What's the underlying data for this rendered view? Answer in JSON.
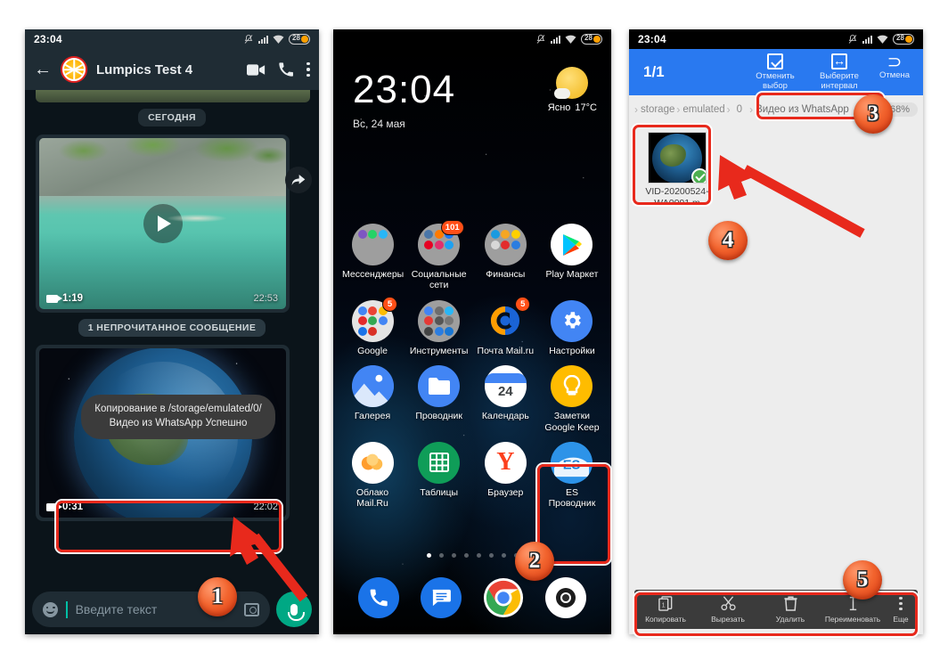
{
  "panels": {
    "whatsapp": {
      "status": {
        "time": "23:04",
        "battery": "28"
      },
      "appbar": {
        "title": "Lumpics Test 4",
        "back_icon": "arrow-left-icon",
        "video_icon": "video-call-icon",
        "call_icon": "phone-call-icon",
        "menu_icon": "overflow-menu-icon"
      },
      "divider_today": "СЕГОДНЯ",
      "unread_pill": "1 НЕПРОЧИТАННОЕ СООБЩЕНИЕ",
      "messages": [
        {
          "type": "video",
          "duration": "1:19",
          "time": "22:53"
        },
        {
          "type": "video",
          "duration": "0:31",
          "time": "22:02"
        }
      ],
      "toast": "Копирование в /storage/emulated/0/Видео из WhatsApp Успешно",
      "input": {
        "placeholder": "Введите текст",
        "emoji_icon": "emoji-icon",
        "camera_icon": "camera-icon",
        "mic_icon": "microphone-icon"
      }
    },
    "home": {
      "status": {
        "time": "",
        "battery": "28"
      },
      "clock": {
        "time": "23:04",
        "date": "Вс, 24 мая"
      },
      "weather": {
        "condition": "Ясно",
        "temp": "17°C"
      },
      "apps_row1": [
        {
          "label": "Мессенджеры",
          "type": "folder",
          "badge": ""
        },
        {
          "label": "Социальные сети",
          "type": "folder",
          "badge": "101"
        },
        {
          "label": "Финансы",
          "type": "folder",
          "badge": ""
        },
        {
          "label": "Play Маркет",
          "type": "app",
          "badge": ""
        }
      ],
      "apps_row2": [
        {
          "label": "Google",
          "type": "folder",
          "badge": "5"
        },
        {
          "label": "Инструменты",
          "type": "folder",
          "badge": ""
        },
        {
          "label": "Почта Mail.ru",
          "type": "app",
          "badge": "5"
        },
        {
          "label": "Настройки",
          "type": "app",
          "badge": ""
        }
      ],
      "apps_row3": [
        {
          "label": "Галерея",
          "type": "app",
          "badge": ""
        },
        {
          "label": "Проводник",
          "type": "app",
          "badge": ""
        },
        {
          "label": "Календарь",
          "type": "app",
          "badge": "",
          "day": "24"
        },
        {
          "label": "Заметки Google Keep",
          "type": "app",
          "badge": ""
        }
      ],
      "apps_row4": [
        {
          "label": "Облако Mail.Ru",
          "type": "app",
          "badge": ""
        },
        {
          "label": "Таблицы",
          "type": "app",
          "badge": ""
        },
        {
          "label": "Браузер",
          "type": "app",
          "badge": ""
        },
        {
          "label": "ES Проводник",
          "type": "app",
          "badge": ""
        }
      ],
      "dock": [
        "phone-icon",
        "messages-icon",
        "chrome-icon",
        "camera-icon"
      ],
      "page_dots": 8,
      "page_active": 0
    },
    "es": {
      "status": {
        "time": "23:04",
        "battery": "28"
      },
      "appbar": {
        "count": "1/1",
        "actions": [
          {
            "label": "Отменить выбор",
            "icon": "checkbox-icon"
          },
          {
            "label": "Выберите интервал",
            "icon": "select-range-icon"
          },
          {
            "label": "Отмена",
            "icon": "undo-icon"
          }
        ]
      },
      "breadcrumbs": [
        "storage",
        "emulated",
        "0",
        "Видео из WhatsApp"
      ],
      "storage_pct": "68%",
      "file": {
        "name": "VID-20200524-WA0001.m",
        "selected": true
      },
      "bottom_actions": [
        {
          "label": "Копировать",
          "icon": "copy-icon"
        },
        {
          "label": "Вырезать",
          "icon": "cut-icon"
        },
        {
          "label": "Удалить",
          "icon": "trash-icon"
        },
        {
          "label": "Переименовать",
          "icon": "rename-icon"
        },
        {
          "label": "Еще",
          "icon": "more-icon"
        }
      ]
    }
  },
  "annotations": {
    "steps": [
      "1",
      "2",
      "3",
      "4",
      "5"
    ],
    "accent": "#e8291c"
  }
}
